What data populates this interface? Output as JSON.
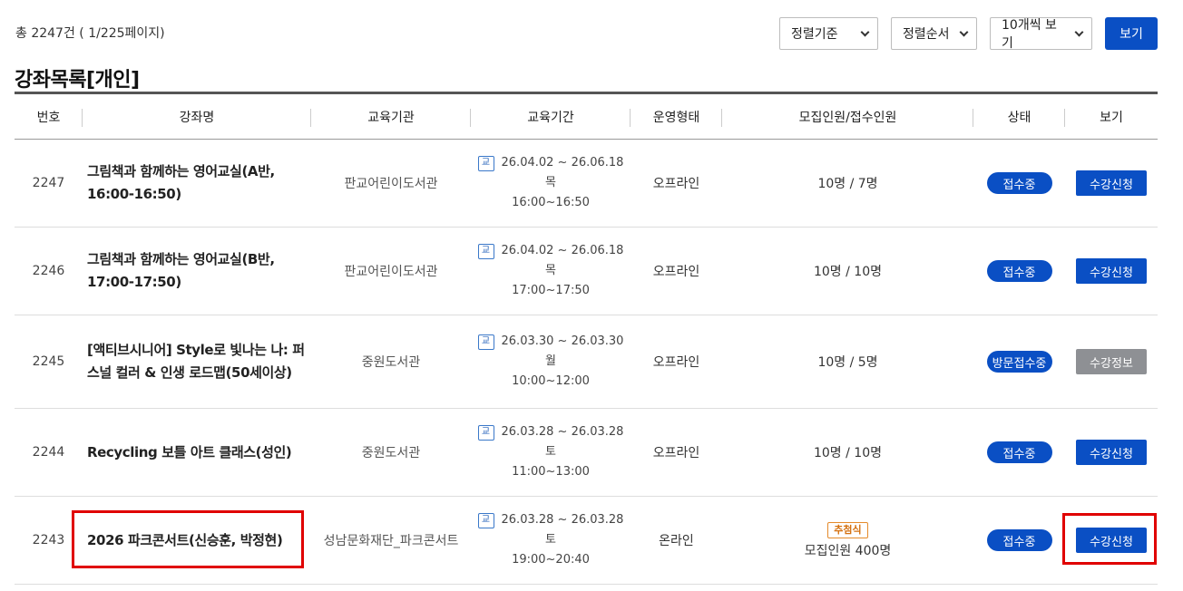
{
  "summary": {
    "total_text": "총 2247건 ( 1/225페이지)"
  },
  "controls": {
    "sort_key": "정렬기준",
    "sort_order": "정렬순서",
    "per_page": "10개씩 보기",
    "view_button": "보기"
  },
  "list_title": "강좌목록[개인]",
  "headers": {
    "no": "번호",
    "name": "강좌명",
    "org": "교육기관",
    "period": "교육기간",
    "type": "운영형태",
    "capacity": "모집인원/접수인원",
    "status": "상태",
    "view": "보기"
  },
  "period_icon": "교",
  "rows": [
    {
      "no": "2247",
      "name": "그림책과 함께하는 영어교실(A반, 16:00-16:50)",
      "org": "판교어린이도서관",
      "date_range": "26.04.02 ~ 26.06.18",
      "weekday": "목",
      "time": "16:00~16:50",
      "type": "오프라인",
      "capacity": "10명 / 7명",
      "status": "접수중",
      "action": "수강신청"
    },
    {
      "no": "2246",
      "name": "그림책과 함께하는 영어교실(B반, 17:00-17:50)",
      "org": "판교어린이도서관",
      "date_range": "26.04.02 ~ 26.06.18",
      "weekday": "목",
      "time": "17:00~17:50",
      "type": "오프라인",
      "capacity": "10명 / 10명",
      "status": "접수중",
      "action": "수강신청"
    },
    {
      "no": "2245",
      "name": "[액티브시니어] Style로 빛나는 나: 퍼스널 컬러 & 인생 로드맵(50세이상)",
      "org": "중원도서관",
      "date_range": "26.03.30 ~ 26.03.30",
      "weekday": "월",
      "time": "10:00~12:00",
      "type": "오프라인",
      "capacity": "10명 / 5명",
      "status": "방문접수중",
      "action": "수강정보"
    },
    {
      "no": "2244",
      "name": "Recycling 보틀 아트 클래스(성인)",
      "org": "중원도서관",
      "date_range": "26.03.28 ~ 26.03.28",
      "weekday": "토",
      "time": "11:00~13:00",
      "type": "오프라인",
      "capacity": "10명 / 10명",
      "status": "접수중",
      "action": "수강신청"
    },
    {
      "no": "2243",
      "name": "2026 파크콘서트(신승훈, 박정현)",
      "org": "성남문화재단_파크콘서트",
      "date_range": "26.03.28 ~ 26.03.28",
      "weekday": "토",
      "time": "19:00~20:40",
      "type": "온라인",
      "lottery_badge": "추첨식",
      "capacity": "모집인원 400명",
      "status": "접수중",
      "action": "수강신청"
    }
  ],
  "colors": {
    "primary": "#0a4fc4",
    "gray_button": "#8e9094",
    "lottery": "#d4700e",
    "highlight": "#e00000"
  }
}
